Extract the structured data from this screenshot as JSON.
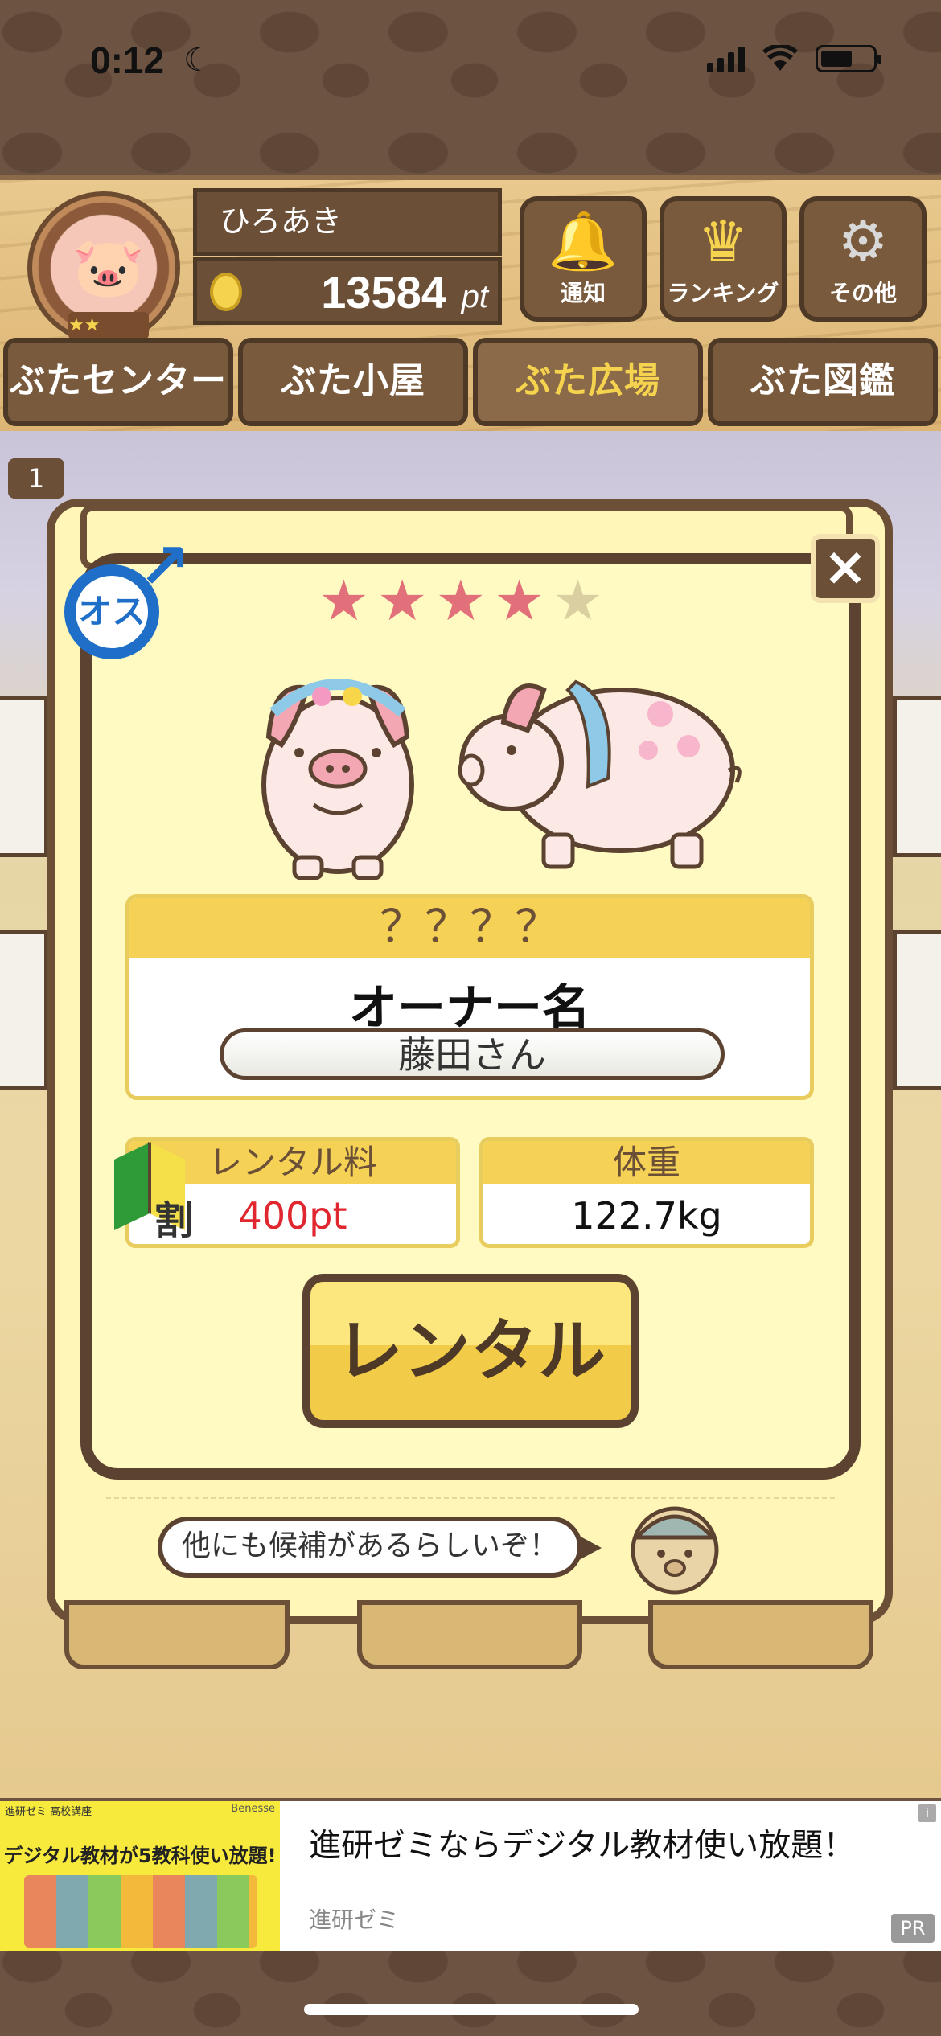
{
  "status": {
    "time": "0:12"
  },
  "header": {
    "user_name": "ひろあき",
    "points": "13584",
    "points_unit": "pt",
    "buttons": [
      {
        "label": "通知",
        "icon": "bell-icon"
      },
      {
        "label": "ランキング",
        "icon": "crown-icon"
      },
      {
        "label": "その他",
        "icon": "gear-icon"
      }
    ],
    "nav_tabs": [
      "ぶたセンター",
      "ぶた小屋",
      "ぶた広場",
      "ぶた図鑑"
    ],
    "active_tab": "ぶた広場"
  },
  "scene": {
    "counter_badge": "1"
  },
  "modal": {
    "gender_label": "オス",
    "stars_filled": 4,
    "stars_total": 5,
    "pig_name": "？？？？",
    "owner_label": "オーナー名",
    "owner_name": "藤田さん",
    "rental_fee_label": "レンタル料",
    "rental_fee_value": "400pt",
    "beginner_mark": "割",
    "weight_label": "体重",
    "weight_value": "122.7kg",
    "rent_button": "レンタル",
    "speech_text": "他にも候補があるらしいぞ！"
  },
  "ad": {
    "image_line1": "進研ゼミ 高校講座",
    "image_brand": "Benesse",
    "image_headline": "デジタル教材が5教科使い放題!",
    "title": "進研ゼミならデジタル教材使い放題！",
    "source": "進研ゼミ",
    "pr_label": "PR",
    "info_label": "i"
  },
  "colors": {
    "wood_dark": "#5c4230",
    "panel_yellow": "#fff9c2",
    "header_yellow": "#f5d256",
    "fee_red": "#e0262e",
    "male_blue": "#1f6fc8",
    "star_pink": "#e2707a",
    "star_empty": "#d9cfa0"
  }
}
